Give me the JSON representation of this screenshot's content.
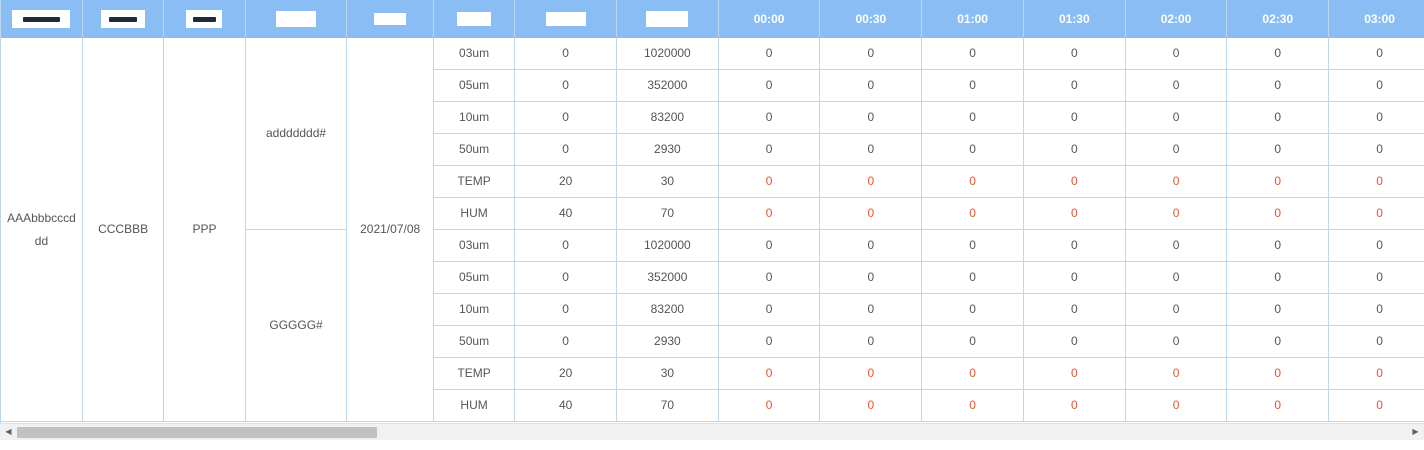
{
  "table": {
    "header": {
      "masked": [
        "",
        "",
        "",
        "",
        "",
        "",
        "",
        ""
      ],
      "times": [
        "00:00",
        "00:30",
        "01:00",
        "01:30",
        "02:00",
        "02:30",
        "03:00"
      ]
    },
    "site": "AAAbbbcccddd",
    "area": "CCCBBB",
    "device": "PPP",
    "date": "2021/07/08",
    "groups": [
      {
        "point": "addddddd#",
        "rows": [
          {
            "item": "03um",
            "min": "0",
            "max": "1020000",
            "vals": [
              "0",
              "0",
              "0",
              "0",
              "0",
              "0",
              "0"
            ],
            "alarm": false
          },
          {
            "item": "05um",
            "min": "0",
            "max": "352000",
            "vals": [
              "0",
              "0",
              "0",
              "0",
              "0",
              "0",
              "0"
            ],
            "alarm": false
          },
          {
            "item": "10um",
            "min": "0",
            "max": "83200",
            "vals": [
              "0",
              "0",
              "0",
              "0",
              "0",
              "0",
              "0"
            ],
            "alarm": false
          },
          {
            "item": "50um",
            "min": "0",
            "max": "2930",
            "vals": [
              "0",
              "0",
              "0",
              "0",
              "0",
              "0",
              "0"
            ],
            "alarm": false
          },
          {
            "item": "TEMP",
            "min": "20",
            "max": "30",
            "vals": [
              "0",
              "0",
              "0",
              "0",
              "0",
              "0",
              "0"
            ],
            "alarm": true
          },
          {
            "item": "HUM",
            "min": "40",
            "max": "70",
            "vals": [
              "0",
              "0",
              "0",
              "0",
              "0",
              "0",
              "0"
            ],
            "alarm": true
          }
        ]
      },
      {
        "point": "GGGGG#",
        "rows": [
          {
            "item": "03um",
            "min": "0",
            "max": "1020000",
            "vals": [
              "0",
              "0",
              "0",
              "0",
              "0",
              "0",
              "0"
            ],
            "alarm": false
          },
          {
            "item": "05um",
            "min": "0",
            "max": "352000",
            "vals": [
              "0",
              "0",
              "0",
              "0",
              "0",
              "0",
              "0"
            ],
            "alarm": false
          },
          {
            "item": "10um",
            "min": "0",
            "max": "83200",
            "vals": [
              "0",
              "0",
              "0",
              "0",
              "0",
              "0",
              "0"
            ],
            "alarm": false
          },
          {
            "item": "50um",
            "min": "0",
            "max": "2930",
            "vals": [
              "0",
              "0",
              "0",
              "0",
              "0",
              "0",
              "0"
            ],
            "alarm": false
          },
          {
            "item": "TEMP",
            "min": "20",
            "max": "30",
            "vals": [
              "0",
              "0",
              "0",
              "0",
              "0",
              "0",
              "0"
            ],
            "alarm": true
          },
          {
            "item": "HUM",
            "min": "40",
            "max": "70",
            "vals": [
              "0",
              "0",
              "0",
              "0",
              "0",
              "0",
              "0"
            ],
            "alarm": true
          }
        ]
      }
    ]
  },
  "colors": {
    "header_bg": "#89bdf3",
    "header_text": "#ffffff",
    "grid_line": "#bcd8ee",
    "cell_text": "#555555",
    "alarm_text": "#e8542e"
  },
  "scrollbar": {
    "left_icon": "triangle-left-icon",
    "right_icon": "triangle-right-icon",
    "position": 0.0
  }
}
